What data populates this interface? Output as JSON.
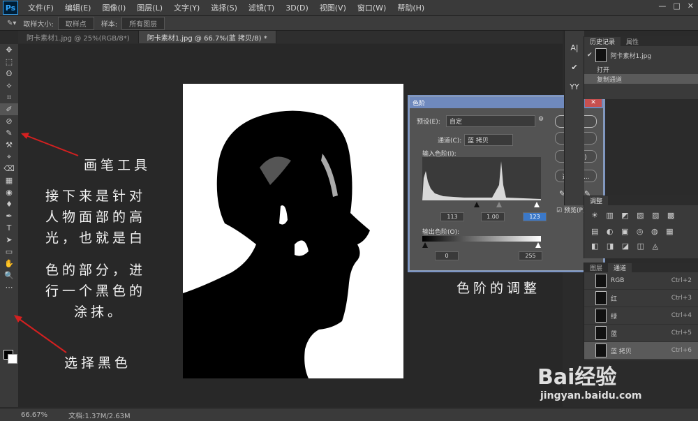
{
  "app": {
    "logo": "Ps"
  },
  "menubar": {
    "items": [
      "文件(F)",
      "编辑(E)",
      "图像(I)",
      "图层(L)",
      "文字(Y)",
      "选择(S)",
      "滤镜(T)",
      "3D(D)",
      "视图(V)",
      "窗口(W)",
      "帮助(H)"
    ],
    "window_controls": [
      "—",
      "□",
      "✕"
    ]
  },
  "options_bar": {
    "sample_size_label": "取样大小:",
    "sample_size_value": "取样点",
    "sample_label": "样本:",
    "sample_value": "所有图层"
  },
  "tabs": [
    {
      "label": "阿卡素材1.jpg @ 25%(RGB/8*)"
    },
    {
      "label": "阿卡素材1.jpg @ 66.7%(蓝 拷贝/8) *"
    }
  ],
  "tools": [
    "✥",
    "⬚",
    "ʘ",
    "⟡",
    "⌗",
    "✐",
    "⊘",
    "✎",
    "⚒",
    "⌖",
    "⌫",
    "▦",
    "◉",
    "♦",
    "✒",
    "T",
    "➤",
    "▭",
    "✋",
    "🔍",
    "⋯"
  ],
  "colors": {
    "foreground": "#000000",
    "background": "#ffffff",
    "arrow": "#d42020",
    "dialog_title": "#6f89bd"
  },
  "annotations": {
    "brush_tool": "画笔工具",
    "instruction_lines": [
      "接下来是针对",
      "人物面部的高",
      "光，也就是白",
      "色的部分，进",
      "行一个黑色的",
      "涂抹。"
    ],
    "choose_black": "选择黑色",
    "levels_adjust": "色阶的调整"
  },
  "levels_dialog": {
    "title": "色阶",
    "preset_label": "预设(E):",
    "preset_value": "自定",
    "channel_label": "通道(C):",
    "channel_value": "蓝 拷贝",
    "input_levels_label": "输入色阶(I):",
    "input_values": [
      "113",
      "1.00",
      "123"
    ],
    "output_levels_label": "输出色阶(O):",
    "output_values": [
      "0",
      "255"
    ],
    "buttons": [
      "确定",
      "复位",
      "自动(A)",
      "选项(T)..."
    ],
    "preview_label": "预览(P)",
    "preview_checked": true
  },
  "right_icons": [
    "A|",
    "✔",
    "YY"
  ],
  "history_panel": {
    "tabs": [
      "历史记录",
      "属性"
    ],
    "snapshot": "阿卡素材1.jpg",
    "items": [
      {
        "label": "打开"
      },
      {
        "label": "复制通道"
      }
    ]
  },
  "adjustments_panel": {
    "tabs": [
      "调整"
    ]
  },
  "channels_panel": {
    "tabs": [
      "图层",
      "通道"
    ],
    "rows": [
      {
        "name": "RGB",
        "shortcut": "Ctrl+2"
      },
      {
        "name": "红",
        "shortcut": "Ctrl+3"
      },
      {
        "name": "绿",
        "shortcut": "Ctrl+4"
      },
      {
        "name": "蓝",
        "shortcut": "Ctrl+5"
      },
      {
        "name": "蓝 拷贝",
        "shortcut": "Ctrl+6"
      }
    ]
  },
  "status": {
    "zoom": "66.67%",
    "doc_info": "文档:1.37M/2.63M"
  },
  "watermark": {
    "brand": "Bai经验",
    "url": "jingyan.baidu.com"
  }
}
